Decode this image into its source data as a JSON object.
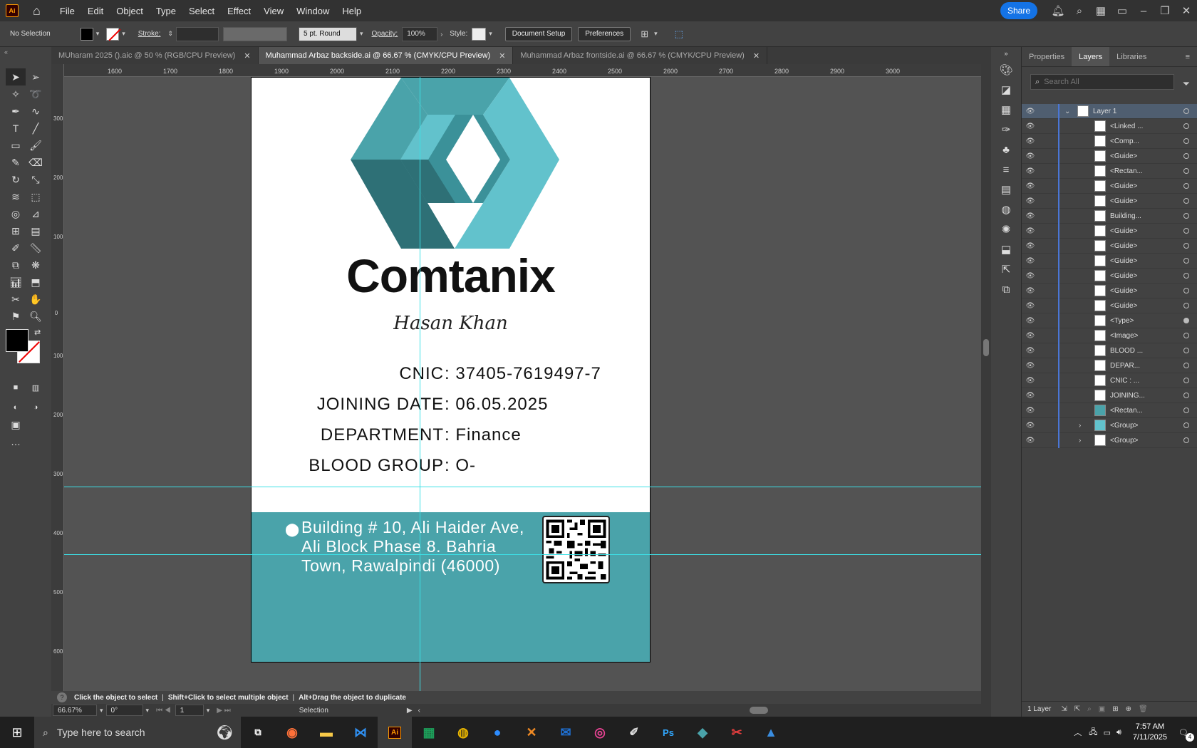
{
  "app": {
    "logo": "Ai",
    "menus": [
      "File",
      "Edit",
      "Object",
      "Type",
      "Select",
      "Effect",
      "View",
      "Window",
      "Help"
    ],
    "share": "Share"
  },
  "control": {
    "selection": "No Selection",
    "stroke_label": "Stroke:",
    "brush": "5 pt. Round",
    "opacity_label": "Opacity:",
    "opacity": "100%",
    "style_label": "Style:",
    "doc_setup": "Document Setup",
    "preferences": "Preferences"
  },
  "tabs": [
    {
      "label": "MUharam 2025 ().aic @ 50 % (RGB/CPU Preview)"
    },
    {
      "label": "Muhammad Arbaz backside.ai @ 66.67 % (CMYK/CPU Preview)"
    },
    {
      "label": "Muhammad Arbaz frontside.ai @ 66.67 % (CMYK/CPU Preview)"
    }
  ],
  "ruler": {
    "h": [
      "1600",
      "1700",
      "1800",
      "1900",
      "2000",
      "2100",
      "2200",
      "2300",
      "2400",
      "2500",
      "2600",
      "2700",
      "2800",
      "2900",
      "3000"
    ],
    "v": [
      "300",
      "200",
      "100",
      "0",
      "100",
      "200",
      "300",
      "400",
      "500",
      "600"
    ]
  },
  "card": {
    "brand": "Comtanix",
    "signature": "Hasan Khan",
    "fields": [
      {
        "key": "CNIC",
        "value": "37405-7619497-7"
      },
      {
        "key": "JOINING DATE",
        "value": "06.05.2025"
      },
      {
        "key": "DEPARTMENT",
        "value": "Finance"
      },
      {
        "key": "BLOOD GROUP",
        "value": "O-"
      }
    ],
    "address": [
      "Building # 10, Ali Haider Ave,",
      "Ali Block Phase 8. Bahria",
      "Town, Rawalpindi (46000)"
    ],
    "colors": {
      "teal": "#4aa3aa",
      "dark": "#2e7076",
      "mid": "#4aa3aa",
      "light": "#62c2cc"
    }
  },
  "status": {
    "hint_a": "Click the object to select",
    "hint_b": "Shift+Click to select multiple object",
    "hint_c": "Alt+Drag the object to duplicate",
    "zoom": "66.67%",
    "angle": "0°",
    "artboard": "1",
    "tool": "Selection"
  },
  "panel": {
    "tabs": [
      "Properties",
      "Layers",
      "Libraries"
    ],
    "search_placeholder": "Search All",
    "footer": "1 Layer",
    "layers": [
      {
        "name": "Layer 1"
      },
      {
        "name": "<Linked ..."
      },
      {
        "name": "<Comp..."
      },
      {
        "name": "<Guide>"
      },
      {
        "name": "<Rectan..."
      },
      {
        "name": "<Guide>"
      },
      {
        "name": "<Guide>"
      },
      {
        "name": "Building..."
      },
      {
        "name": "<Guide>"
      },
      {
        "name": "<Guide>"
      },
      {
        "name": "<Guide>"
      },
      {
        "name": "<Guide>"
      },
      {
        "name": "<Guide>"
      },
      {
        "name": "<Guide>"
      },
      {
        "name": "<Type>"
      },
      {
        "name": "<Image>"
      },
      {
        "name": "BLOOD ..."
      },
      {
        "name": "DEPAR..."
      },
      {
        "name": "CNIC : ..."
      },
      {
        "name": "JOINING..."
      },
      {
        "name": "<Rectan..."
      },
      {
        "name": "<Group>"
      },
      {
        "name": "<Group>"
      }
    ]
  },
  "taskbar": {
    "search": "Type here to search",
    "time": "7:57 AM",
    "date": "7/11/2025",
    "notif": "4",
    "apps": [
      "Ps"
    ]
  }
}
